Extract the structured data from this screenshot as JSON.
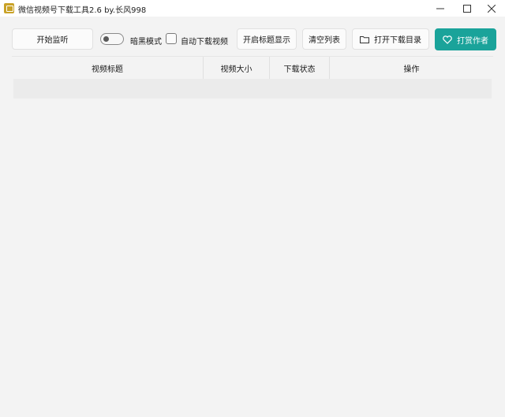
{
  "window": {
    "title": "微信视频号下载工具2.6 by.长风998",
    "icon": "app-icon"
  },
  "toolbar": {
    "start_monitor_label": "开始监听",
    "dark_mode_label": "暗黑模式",
    "dark_mode_on": false,
    "auto_download_label": "自动下载视频",
    "auto_download_checked": false,
    "title_show_label": "开启标题显示",
    "clear_list_label": "清空列表",
    "open_dir_label": "打开下载目录",
    "open_dir_icon": "folder-icon",
    "reward_label": "打赏作者",
    "reward_icon": "heart-icon"
  },
  "table": {
    "columns": [
      "视频标题",
      "视频大小",
      "下载状态",
      "操作"
    ],
    "rows": []
  },
  "colors": {
    "accent": "#1aa39a",
    "background": "#f3f3f3",
    "titlebar": "#ffffff"
  }
}
